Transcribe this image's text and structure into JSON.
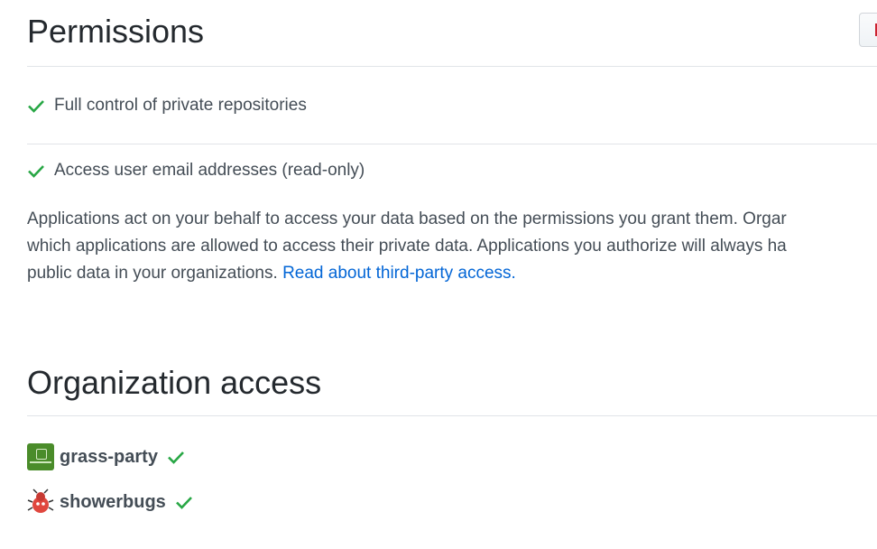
{
  "permissions": {
    "title": "Permissions",
    "items": [
      {
        "label": "Full control of private repositories"
      },
      {
        "label": "Access user email addresses (read-only)"
      }
    ],
    "description": {
      "line1": "Applications act on your behalf to access your data based on the permissions you grant them. Orgar",
      "line2": "which applications are allowed to access their private data. Applications you authorize will always ha",
      "line3": "public data in your organizations.",
      "link": "Read about third-party access."
    }
  },
  "organizations": {
    "title": "Organization access",
    "items": [
      {
        "name": "grass-party",
        "icon": "grass-party-avatar"
      },
      {
        "name": "showerbugs",
        "icon": "showerbugs-avatar"
      }
    ]
  },
  "colors": {
    "check": "#28a745",
    "link": "#0366d6",
    "revoke": "#cb2431"
  }
}
